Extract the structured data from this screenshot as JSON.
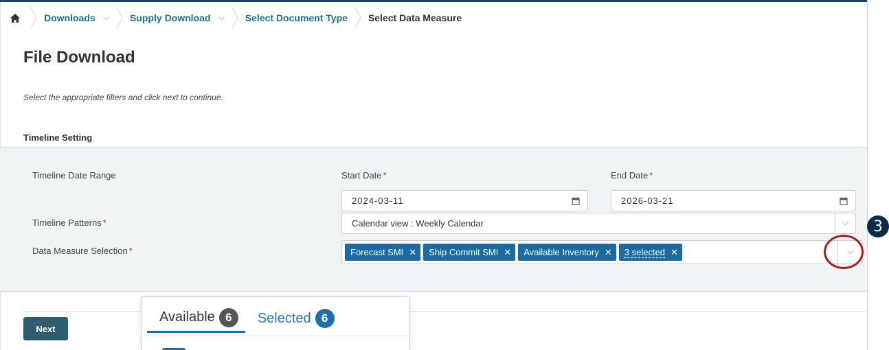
{
  "breadcrumb": {
    "items": [
      {
        "label": "Downloads"
      },
      {
        "label": "Supply Download"
      },
      {
        "label": "Select Document Type"
      }
    ],
    "current": "Select Data Measure"
  },
  "page": {
    "title": "File Download",
    "instructions": "Select the appropriate filters and click next to continue."
  },
  "timeline": {
    "section_title": "Timeline Setting",
    "date_range_label": "Timeline Date Range",
    "start_date_label": "Start Date",
    "start_date_value": "2024-03-11",
    "end_date_label": "End Date",
    "end_date_value": "2026-03-21",
    "patterns_label": "Timeline Patterns",
    "patterns_value": "Calendar view : Weekly Calendar",
    "measure_label": "Data Measure Selection",
    "required_mark": "*",
    "measure_chips": [
      "Forecast SMI",
      "Ship Commit SMI",
      "Available Inventory"
    ],
    "more_selected": "3 selected"
  },
  "actions": {
    "next_label": "Next"
  },
  "popup": {
    "available_label": "Available",
    "available_count": "6",
    "selected_label": "Selected",
    "selected_count": "6"
  },
  "annotation": {
    "step_number": "3"
  },
  "colors": {
    "accent": "#1e6fa8",
    "chip": "#1a6aa4",
    "button": "#2e5d6f",
    "highlight_ring": "#b01e1e",
    "required": "#c0392b"
  }
}
